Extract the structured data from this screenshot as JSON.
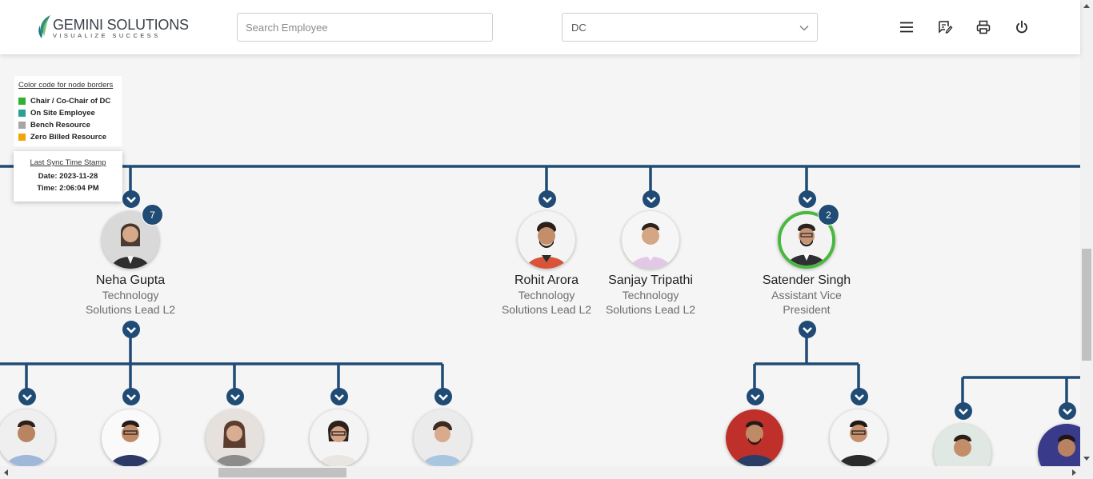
{
  "header": {
    "logo_name": "GEMINI SOLUTIONS",
    "logo_tagline": "VISUALIZE SUCCESS",
    "search_placeholder": "Search Employee",
    "dc_select_value": "DC",
    "icons": [
      "menu-icon",
      "feedback-icon",
      "print-icon",
      "power-icon"
    ]
  },
  "legend": {
    "title": "Color code for node borders",
    "items": [
      {
        "label": "Chair / Co-Chair of DC",
        "color": "#2fb22f"
      },
      {
        "label": "On Site Employee",
        "color": "#2aa198"
      },
      {
        "label": "Bench Resource",
        "color": "#a6a6a6"
      },
      {
        "label": "Zero Billed Resource",
        "color": "#f5a30a"
      }
    ]
  },
  "sync": {
    "title": "Last Sync Time Stamp",
    "date": "Date: 2023-11-28",
    "time": "Time: 2:06:04 PM"
  },
  "colors": {
    "connector": "#1f4b75",
    "badge": "#1f4b75",
    "chair_border": "#48b83f"
  },
  "employees": [
    {
      "name": "Neha Gupta",
      "role_line1": "Technology",
      "role_line2": "Solutions Lead L2",
      "reports": "7"
    },
    {
      "name": "Rohit Arora",
      "role_line1": "Technology",
      "role_line2": "Solutions Lead L2"
    },
    {
      "name": "Sanjay Tripathi",
      "role_line1": "Technology",
      "role_line2": "Solutions Lead L2"
    },
    {
      "name": "Satender Singh",
      "role_line1": "Assistant Vice",
      "role_line2": "President",
      "reports": "2",
      "border": "Chair / Co-Chair of DC"
    }
  ]
}
